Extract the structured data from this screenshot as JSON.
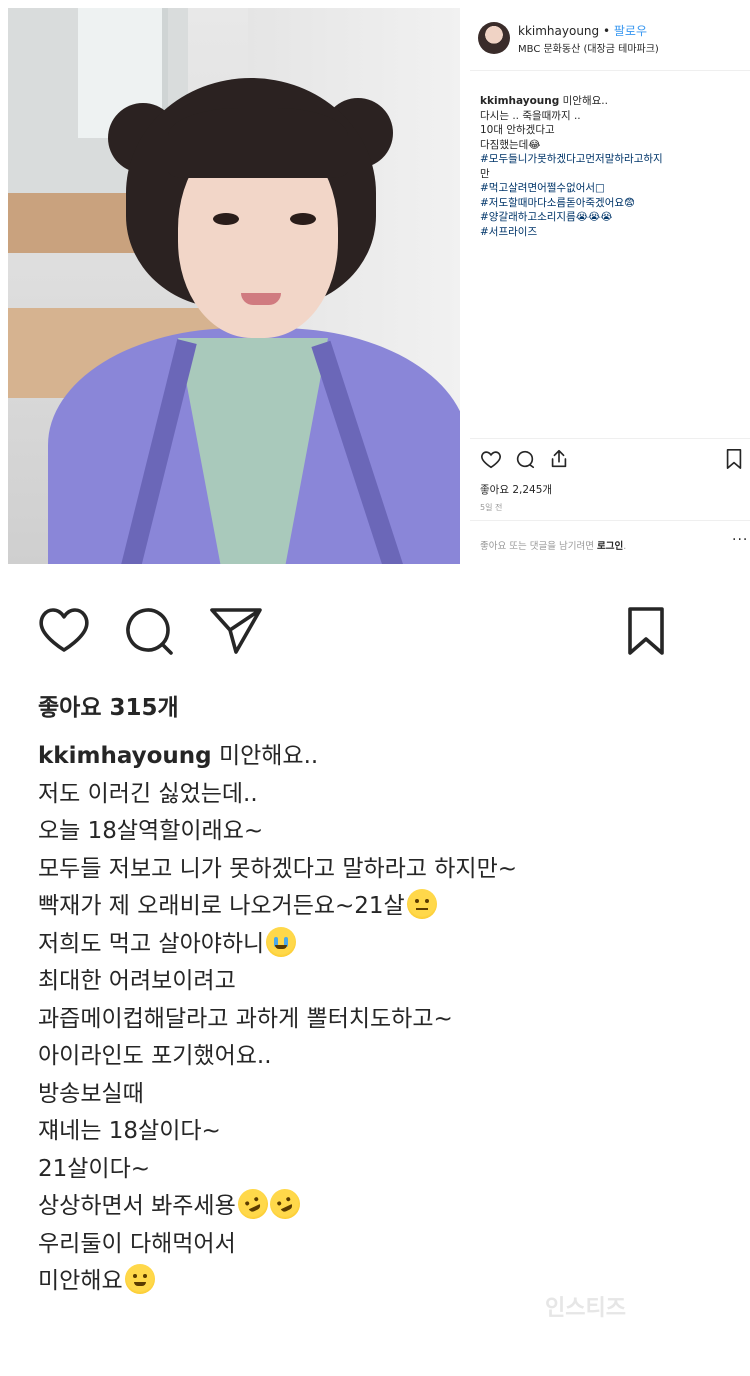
{
  "top_post": {
    "username": "kkimhayoung",
    "separator": "•",
    "follow_label": "팔로우",
    "location": "MBC 문화동산 (대장금 테마파크)",
    "caption_lines": [
      {
        "kind": "first",
        "username": "kkimhayoung",
        "text": " 미안해요.."
      },
      {
        "kind": "text",
        "text": "다시는 .. 죽을때까지 .."
      },
      {
        "kind": "text",
        "text": "10대 안하겠다고"
      },
      {
        "kind": "text",
        "text": "다짐했는데😂"
      },
      {
        "kind": "tag",
        "text": "#모두들니가못하겠다고먼저말하라고하지"
      },
      {
        "kind": "text",
        "text": "만"
      },
      {
        "kind": "tag",
        "text": "#먹고살려면어쩔수없어서□"
      },
      {
        "kind": "tag",
        "text": "#저도할때마다소름돋아죽겠어요😨"
      },
      {
        "kind": "tag",
        "text": "#양갈래하고소리지름😭😭😭"
      },
      {
        "kind": "tag",
        "text": "#서프라이즈"
      }
    ],
    "likes": "좋아요 2,245개",
    "time": "5일 전",
    "login_prompt_prefix": "좋아요 또는 댓글을 남기려면 ",
    "login_link": "로그인",
    "login_prompt_suffix": ".",
    "more": "···"
  },
  "bottom_post": {
    "likes": "좋아요 315개",
    "caption": {
      "username": "kkimhayoung",
      "first_line_text": " 미안해요..",
      "lines": [
        {
          "text": "저도 이러긴 싫었는데..",
          "emoji": []
        },
        {
          "text": "오늘 18살역할이래요~",
          "emoji": []
        },
        {
          "text": "모두들 저보고 니가 못하겠다고 말하라고 하지만~",
          "emoji": []
        },
        {
          "text": "빡재가 제 오래비로 나오거든요~21살",
          "emoji": [
            "meh-face-emoji"
          ]
        },
        {
          "text": "저희도 먹고 살아야하니",
          "emoji": [
            "crying-face-emoji"
          ]
        },
        {
          "text": "최대한 어려보이려고",
          "emoji": []
        },
        {
          "text": "과즙메이컵해달라고 과하게 뽈터치도하고~",
          "emoji": []
        },
        {
          "text": "아이라인도 포기했어요..",
          "emoji": []
        },
        {
          "text": "방송보실때",
          "emoji": []
        },
        {
          "text": "쟤네는 18살이다~",
          "emoji": []
        },
        {
          "text": "21살이다~",
          "emoji": []
        },
        {
          "text": "상상하면서 봐주세용",
          "emoji": [
            "rofl-emoji",
            "rofl-emoji"
          ]
        },
        {
          "text": "우리둘이 다해먹어서",
          "emoji": []
        },
        {
          "text": "미안해요",
          "emoji": [
            "sweat-smile-emoji"
          ]
        }
      ]
    },
    "watermark": "인스티즈"
  },
  "colors": {
    "link_blue": "#3897f0",
    "hashtag_blue": "#003569",
    "text_dark": "#262626",
    "muted_gray": "#999999"
  }
}
